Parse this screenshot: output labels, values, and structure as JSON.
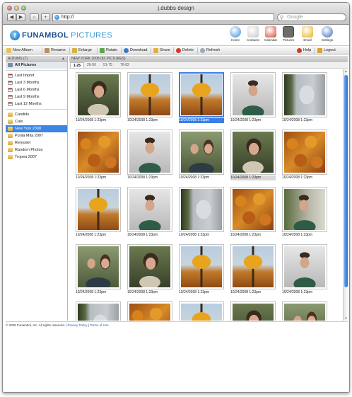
{
  "window": {
    "title": "j.dubbs design"
  },
  "browser": {
    "url": "http://",
    "search_placeholder": "Google",
    "back_label": "◀",
    "forward_label": "▶",
    "add_label": "+",
    "home_label": "⌂"
  },
  "app": {
    "name_part1": "FUNAMBOL",
    "name_part2": "PICTURES",
    "logo_letter": "f",
    "modules": [
      {
        "label": "Home",
        "icon": "home-icon",
        "color": "#3a8ad8"
      },
      {
        "label": "Contacts",
        "icon": "contacts-icon",
        "color": "#c8c8c8"
      },
      {
        "label": "Calendar",
        "icon": "calendar-icon",
        "color": "#d04a3a"
      },
      {
        "label": "Pictures",
        "icon": "pictures-icon",
        "color": "#6c6c6c"
      },
      {
        "label": "Email",
        "icon": "email-icon",
        "color": "#e8b21e"
      },
      {
        "label": "Settings",
        "icon": "settings-icon",
        "color": "#3b67b8"
      }
    ],
    "active_module": "Pictures"
  },
  "toolbar": {
    "new_album": "New Album",
    "rename": "Rename",
    "enlarge": "Enlarge",
    "rotate": "Rotate",
    "download": "Download",
    "share": "Share",
    "delete": "Delete",
    "refresh": "Refresh",
    "help": "Help",
    "logout": "Logout"
  },
  "sidebar": {
    "header": "ALBUMS (7)",
    "collapse": "▲",
    "all": "All Pictures",
    "filters": [
      "Last Import",
      "Last 3 Months",
      "Last 6 Months",
      "Last 9 Months",
      "Last 12 Months"
    ],
    "albums": [
      "Candids",
      "Cats",
      "New York 2008",
      "Punta Mita 2007",
      "Remodel",
      "Random Photos",
      "Tropea 2007"
    ],
    "selected_album": "New York 2008"
  },
  "main": {
    "header": "NEW YORK 2008 (82 PICTURES)",
    "tabs": [
      "1-25",
      "26-50",
      "51-75",
      "76-82"
    ],
    "selected_tab": "1-25",
    "caption": "10/24/2008 1:23pm",
    "photos": [
      "woman",
      "tree",
      "tree",
      "man",
      "wall",
      "leaves",
      "man",
      "couple",
      "woman",
      "leaves",
      "tree",
      "man",
      "wall",
      "leaves",
      "manw",
      "couple",
      "woman",
      "tree",
      "tree",
      "man",
      "wall",
      "leaves",
      "tree",
      "woman",
      "couple"
    ],
    "selected_index": 2,
    "highlight_index": 8
  },
  "footer": {
    "copyright": "© 2008 Funambol, Inc. All rights reserved.",
    "sep": " | ",
    "privacy": "Privacy Policy",
    "terms": "Terms of Use"
  },
  "colors": {
    "accent": "#3a86e2",
    "brand": "#1a4f8f"
  }
}
